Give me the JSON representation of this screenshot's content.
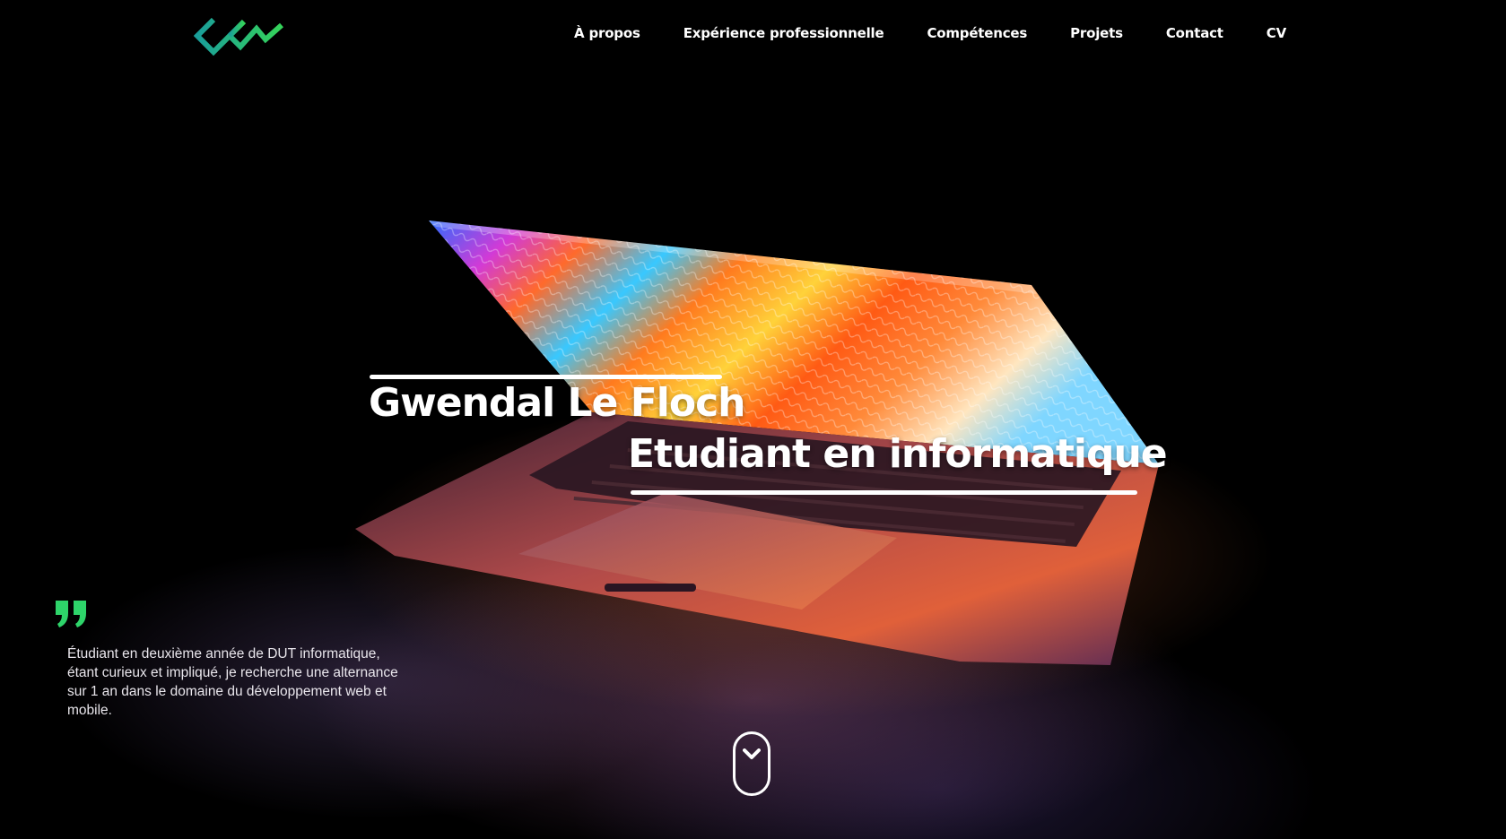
{
  "nav": {
    "logo_icon": "gwlf-logo-icon",
    "items": [
      {
        "label": "À propos"
      },
      {
        "label": "Expérience professionnelle"
      },
      {
        "label": "Compétences"
      },
      {
        "label": "Projets"
      },
      {
        "label": "Contact"
      },
      {
        "label": "CV"
      }
    ]
  },
  "hero": {
    "name": "Gwendal Le Floch",
    "role": "Etudiant en informatique",
    "background_image": "laptop-photo"
  },
  "quote": {
    "icon": "quote-icon",
    "text": "Étudiant en deuxième année de DUT informatique, étant curieux et impliqué, je recherche une alternance sur 1 an dans le domaine du développement web et mobile."
  },
  "scroll": {
    "icon": "chevron-down-icon"
  },
  "colors": {
    "background": "#000000",
    "text": "#ffffff",
    "accent_green": "#2ed46a",
    "accent_teal": "#1aa7a0"
  }
}
